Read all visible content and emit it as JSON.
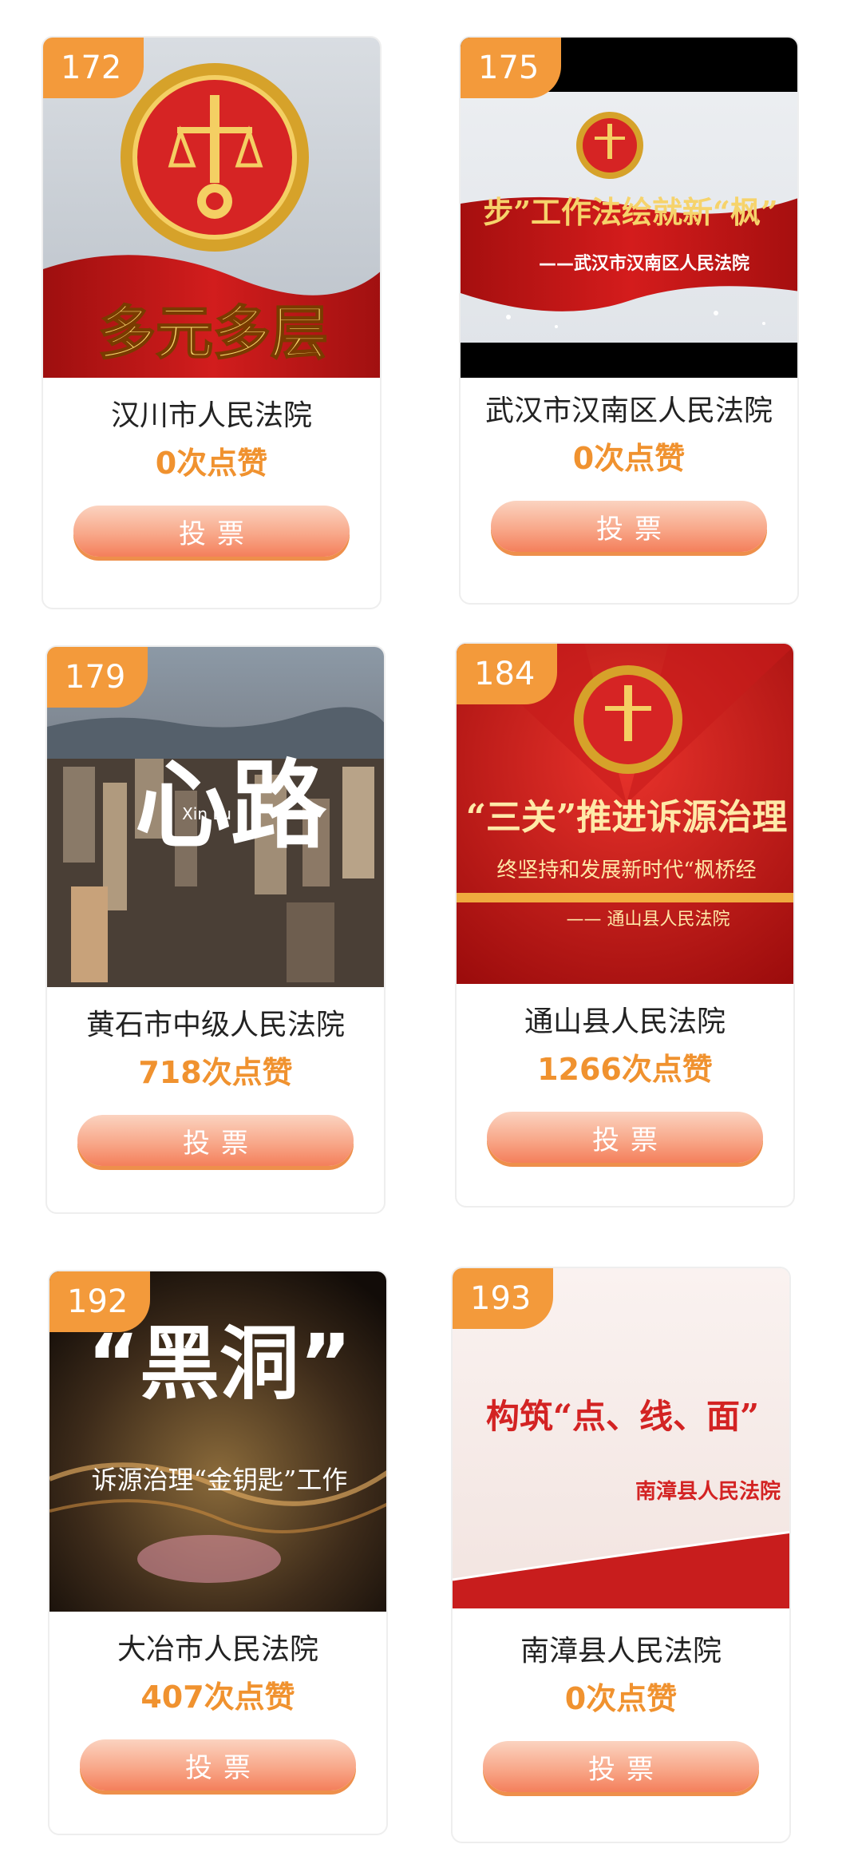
{
  "cards": [
    {
      "number": "172",
      "name": "汉川市人民法院",
      "likes": "0次点赞",
      "vote_label": "投票",
      "thumb_text": {
        "headline": "多元多层"
      }
    },
    {
      "number": "175",
      "name": "武汉市汉南区人民法院",
      "likes": "0次点赞",
      "vote_label": "投票",
      "thumb_text": {
        "headline": "步”工作法绘就新“枫”",
        "sub": "——武汉市汉南区人民法院"
      }
    },
    {
      "number": "179",
      "name": "黄石市中级人民法院",
      "likes": "718次点赞",
      "vote_label": "投票",
      "thumb_text": {
        "headline": "心路",
        "sub": "Xin Lu"
      }
    },
    {
      "number": "184",
      "name": "通山县人民法院",
      "likes": "1266次点赞",
      "vote_label": "投票",
      "thumb_text": {
        "headline": "“三关”推进诉源治理",
        "line2": "终坚持和发展新时代“枫桥经",
        "sub": "—— 通山县人民法院"
      }
    },
    {
      "number": "192",
      "name": "大冶市人民法院",
      "likes": "407次点赞",
      "vote_label": "投票",
      "thumb_text": {
        "headline": "“黑洞”",
        "sub": "诉源治理“金钥匙”工作"
      }
    },
    {
      "number": "193",
      "name": "南漳县人民法院",
      "likes": "0次点赞",
      "vote_label": "投票",
      "thumb_text": {
        "headline": "构筑“点、线、面”",
        "sub": "南漳县人民法院"
      }
    }
  ],
  "colors": {
    "badge": "#f39a3b",
    "likes_text": "#f0922f",
    "button_top": "#fbd3c0",
    "button_bottom": "#f47f5b"
  }
}
